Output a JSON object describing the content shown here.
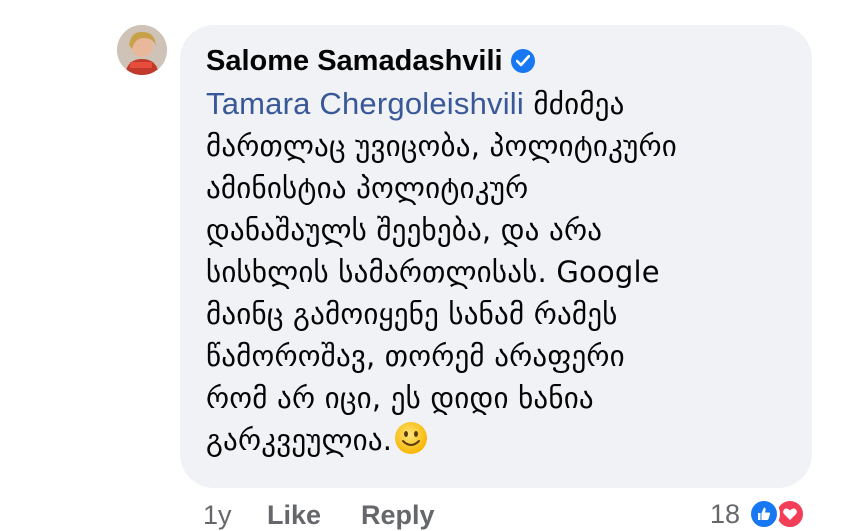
{
  "comment": {
    "author": "Salome Samadashvili",
    "mention": "Tamara Chergoleishvili",
    "lines": [
      "მძიმეა",
      "მართლაც უვიცობა, პოლიტიკური",
      "ამინისტია პოლიტიკურ",
      "დანაშაულს შეეხება, და არა",
      "სისხლის სამართლისას. Google",
      "მაინც გამოიყენე სანამ რამეს",
      "წამოროშავ, თორემ არაფერი",
      "რომ არ იცი, ეს დიდი ხანია",
      "გარკვეულია."
    ],
    "emoji": "slightly-smiling-face"
  },
  "actions": {
    "time": "1y",
    "like": "Like",
    "reply": "Reply"
  },
  "reactions": {
    "count": "18",
    "types": [
      "like",
      "love"
    ]
  },
  "colors": {
    "bubble": "#f0f2f5",
    "mention": "#385898",
    "verified": "#1877f2",
    "like": "#1877f2",
    "love": "#f33e58",
    "meta": "#65676b"
  }
}
